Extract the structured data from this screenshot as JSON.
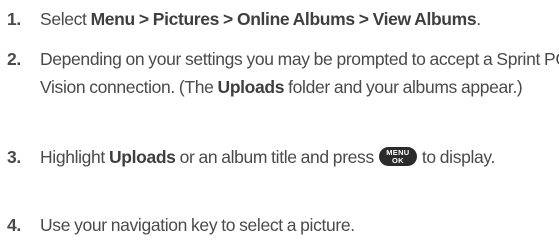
{
  "steps": [
    {
      "number": "1.",
      "t1": "Select ",
      "menu": "Menu",
      "sep1": " > ",
      "pictures": "Pictures",
      "sep2": " > ",
      "online_albums": "Online Albums",
      "sep3": " > ",
      "view_albums": "View Albums",
      "end": "."
    },
    {
      "number": "2.",
      "t1": "Depending on your settings you may be prompted to accept a Sprint PCS Vision connection. (The ",
      "uploads": "Uploads",
      "t2": " folder and your albums appear.)"
    },
    {
      "number": "3.",
      "t1": "Highlight ",
      "uploads": "Uploads",
      "t2": " or an album title and press ",
      "key_top": "MENU",
      "key_bottom": "OK",
      "t3": " to display."
    },
    {
      "number": "4.",
      "t1": "Use your navigation key to select a picture."
    }
  ],
  "colors": {
    "text": "#4a4a4a",
    "key_background": "#2b2b2b",
    "key_text": "#ffffff"
  },
  "icons": {
    "menu_ok_key": "menu-ok-key-icon"
  }
}
